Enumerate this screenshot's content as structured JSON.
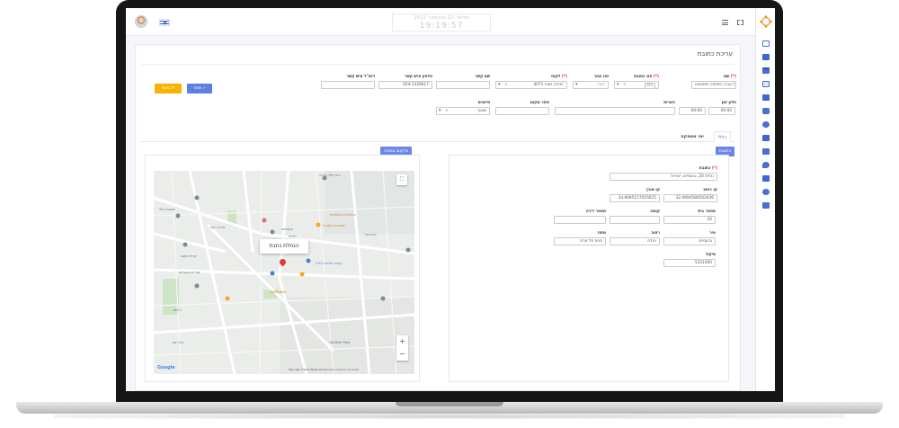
{
  "header": {
    "date_line": "שלישי, 12 בנובמבר 2022",
    "time": "19:19:57"
  },
  "page": {
    "title": "עריכת כתובת"
  },
  "form": {
    "name": {
      "label": "שם",
      "required": "(*)",
      "value": "תל אביב השלמה ושיפוצים"
    },
    "address_type": {
      "label": "סוג כתובת",
      "required": "(*)",
      "value": "בית"
    },
    "other_type": {
      "label": "סוג אחר",
      "value": "לועזי"
    },
    "customer": {
      "label": "לקוח",
      "required": "(*)",
      "value": "4071 מלכה ושות'"
    },
    "contact_name": {
      "label": "שם קשר",
      "value": ""
    },
    "contact_phone": {
      "label": "טלפון איש קשר",
      "value": "054-2326617"
    },
    "contact_email": {
      "label": "דוא\"ל איש קשר",
      "value": ""
    },
    "time_window": {
      "label": "חלון זמן",
      "from": "00:00",
      "to": "00:00"
    },
    "notes": {
      "label": "הערות",
      "value": ""
    },
    "area": {
      "label": "אזור מקום",
      "value": ""
    },
    "classification": {
      "label": "סיווגים",
      "value": "שוטף"
    }
  },
  "buttons": {
    "save": "שמור",
    "cancel": "ביטול"
  },
  "tabs": [
    {
      "label": "כללי"
    },
    {
      "label": "ימי אספקה"
    }
  ],
  "address": {
    "section_title": "כתובת",
    "address_field": {
      "label": "כתובת",
      "required": "(*)",
      "value": "נחלת 20, גבעתיים, ישראל"
    },
    "latitude": {
      "label": "קו רוחב",
      "value": "32.0694589502036"
    },
    "longitude": {
      "label": "קו אורך",
      "value": "34.8095157055615"
    },
    "house_number": {
      "label": "מספר בית",
      "value": "20"
    },
    "floor": {
      "label": "קומה",
      "value": ""
    },
    "apartment": {
      "label": "מספר דירה",
      "value": ""
    },
    "city": {
      "label": "עיר",
      "value": "גבעתיים"
    },
    "street": {
      "label": "רחוב",
      "value": "נחלת"
    },
    "country": {
      "label": "מחוז",
      "value": "מחוז תל אביב"
    },
    "zip": {
      "label": "מיקוד",
      "value": "5321400"
    }
  },
  "map": {
    "section_title": "מיקום במפה",
    "popup": "הנחלת נחבת",
    "attribution": "Map data ©2022 Mapa GISrael   תנאים   דווח על שגיאה במפה",
    "google": "Google",
    "labels": [
      {
        "text": "בית חולי ברכה",
        "style": "gray"
      },
      {
        "text": "גבעתיים",
        "style": "gray"
      },
      {
        "text": "קריית משה",
        "style": "gray"
      },
      {
        "text": "מרכז העיר",
        "style": "gray"
      },
      {
        "text": "נחלת",
        "style": "gray"
      },
      {
        "text": "בית הגדי",
        "style": "gray"
      },
      {
        "text": "שכונת הלל",
        "style": "gray"
      },
      {
        "text": "שדרת גבעתיים",
        "style": "green"
      },
      {
        "text": "המכולת הפלצטית",
        "style": "orange"
      },
      {
        "text": "מוסדות החברה",
        "style": "orange"
      },
      {
        "text": "קופת חולים כללית",
        "style": "blue"
      },
      {
        "text": "JAPANIKA",
        "style": "orange"
      },
      {
        "text": "Malkiel Park",
        "style": "gray"
      },
      {
        "text": "בית יוצר",
        "style": "gray"
      },
      {
        "text": "ורדים",
        "style": "gray"
      }
    ]
  }
}
